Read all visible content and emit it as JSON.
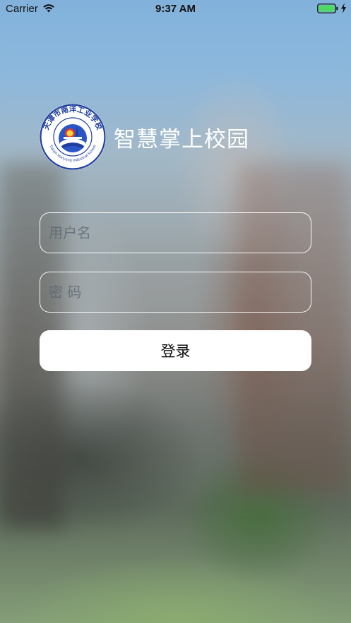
{
  "status_bar": {
    "carrier": "Carrier",
    "time": "9:37 AM",
    "battery_color": "#4cd964"
  },
  "brand": {
    "title": "智慧掌上校园",
    "logo": {
      "top_text": "天津市南洋工业学校",
      "bottom_text": "Tianjin Nanyang Industrial School",
      "colors": {
        "ring": "#1f3f9f",
        "accent": "#e23b2a"
      }
    }
  },
  "form": {
    "username": {
      "placeholder": "用户名",
      "value": ""
    },
    "password": {
      "placeholder": "密 码",
      "value": ""
    },
    "login_label": "登录"
  },
  "icons": {
    "wifi": "wifi-icon",
    "battery": "battery-icon",
    "charging": "charging-bolt-icon"
  }
}
